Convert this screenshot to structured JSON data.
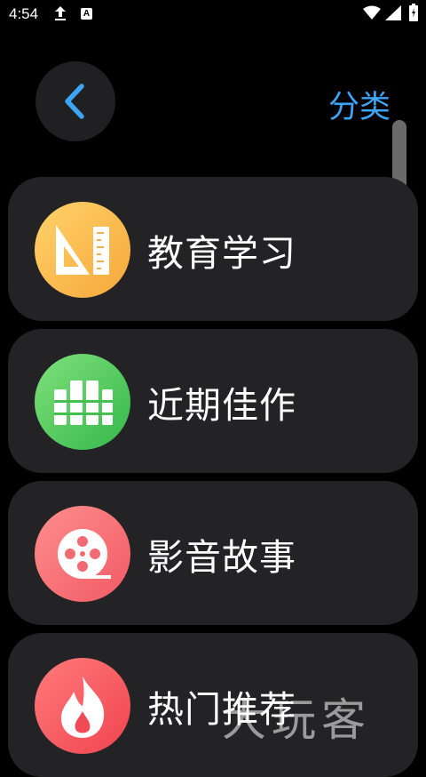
{
  "status_bar": {
    "time": "4:54"
  },
  "header": {
    "title": "分类"
  },
  "categories": [
    {
      "label": "教育学习",
      "icon": "ruler-triangle-icon",
      "color": "#f8b54a"
    },
    {
      "label": "近期佳作",
      "icon": "books-icon",
      "color": "#4cc65a"
    },
    {
      "label": "影音故事",
      "icon": "film-reel-icon",
      "color": "#f46a72"
    },
    {
      "label": "热门推荐",
      "icon": "flame-icon",
      "color": "#f2525c"
    }
  ],
  "watermark": "大玩客",
  "accent_color": "#3ea4f6"
}
